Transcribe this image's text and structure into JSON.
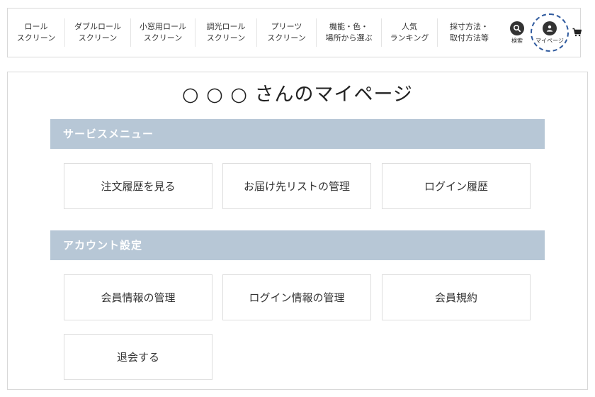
{
  "nav": {
    "items": [
      {
        "line1": "ロール",
        "line2": "スクリーン"
      },
      {
        "line1": "ダブルロール",
        "line2": "スクリーン"
      },
      {
        "line1": "小窓用ロール",
        "line2": "スクリーン"
      },
      {
        "line1": "調光ロール",
        "line2": "スクリーン"
      },
      {
        "line1": "プリーツ",
        "line2": "スクリーン"
      },
      {
        "line1": "機能・色・",
        "line2": "場所から選ぶ"
      },
      {
        "line1": "人気",
        "line2": "ランキング"
      },
      {
        "line1": "採寸方法・",
        "line2": "取付方法等"
      }
    ],
    "search_label": "検索",
    "mypage_label": "マイページ",
    "icons": {
      "search": "search-icon",
      "mypage": "user-icon",
      "cart": "cart-icon"
    },
    "highlight_color": "#2f5a9e"
  },
  "page": {
    "title": "○ ○ ○ さんのマイページ"
  },
  "sections": [
    {
      "title": "サービスメニュー",
      "items": [
        "注文履歴を見る",
        "お届け先リストの管理",
        "ログイン履歴"
      ]
    },
    {
      "title": "アカウント設定",
      "items": [
        "会員情報の管理",
        "ログイン情報の管理",
        "会員規約",
        "退会する"
      ]
    }
  ],
  "colors": {
    "section_header_bg": "#b7c7d6",
    "text": "#333333"
  }
}
